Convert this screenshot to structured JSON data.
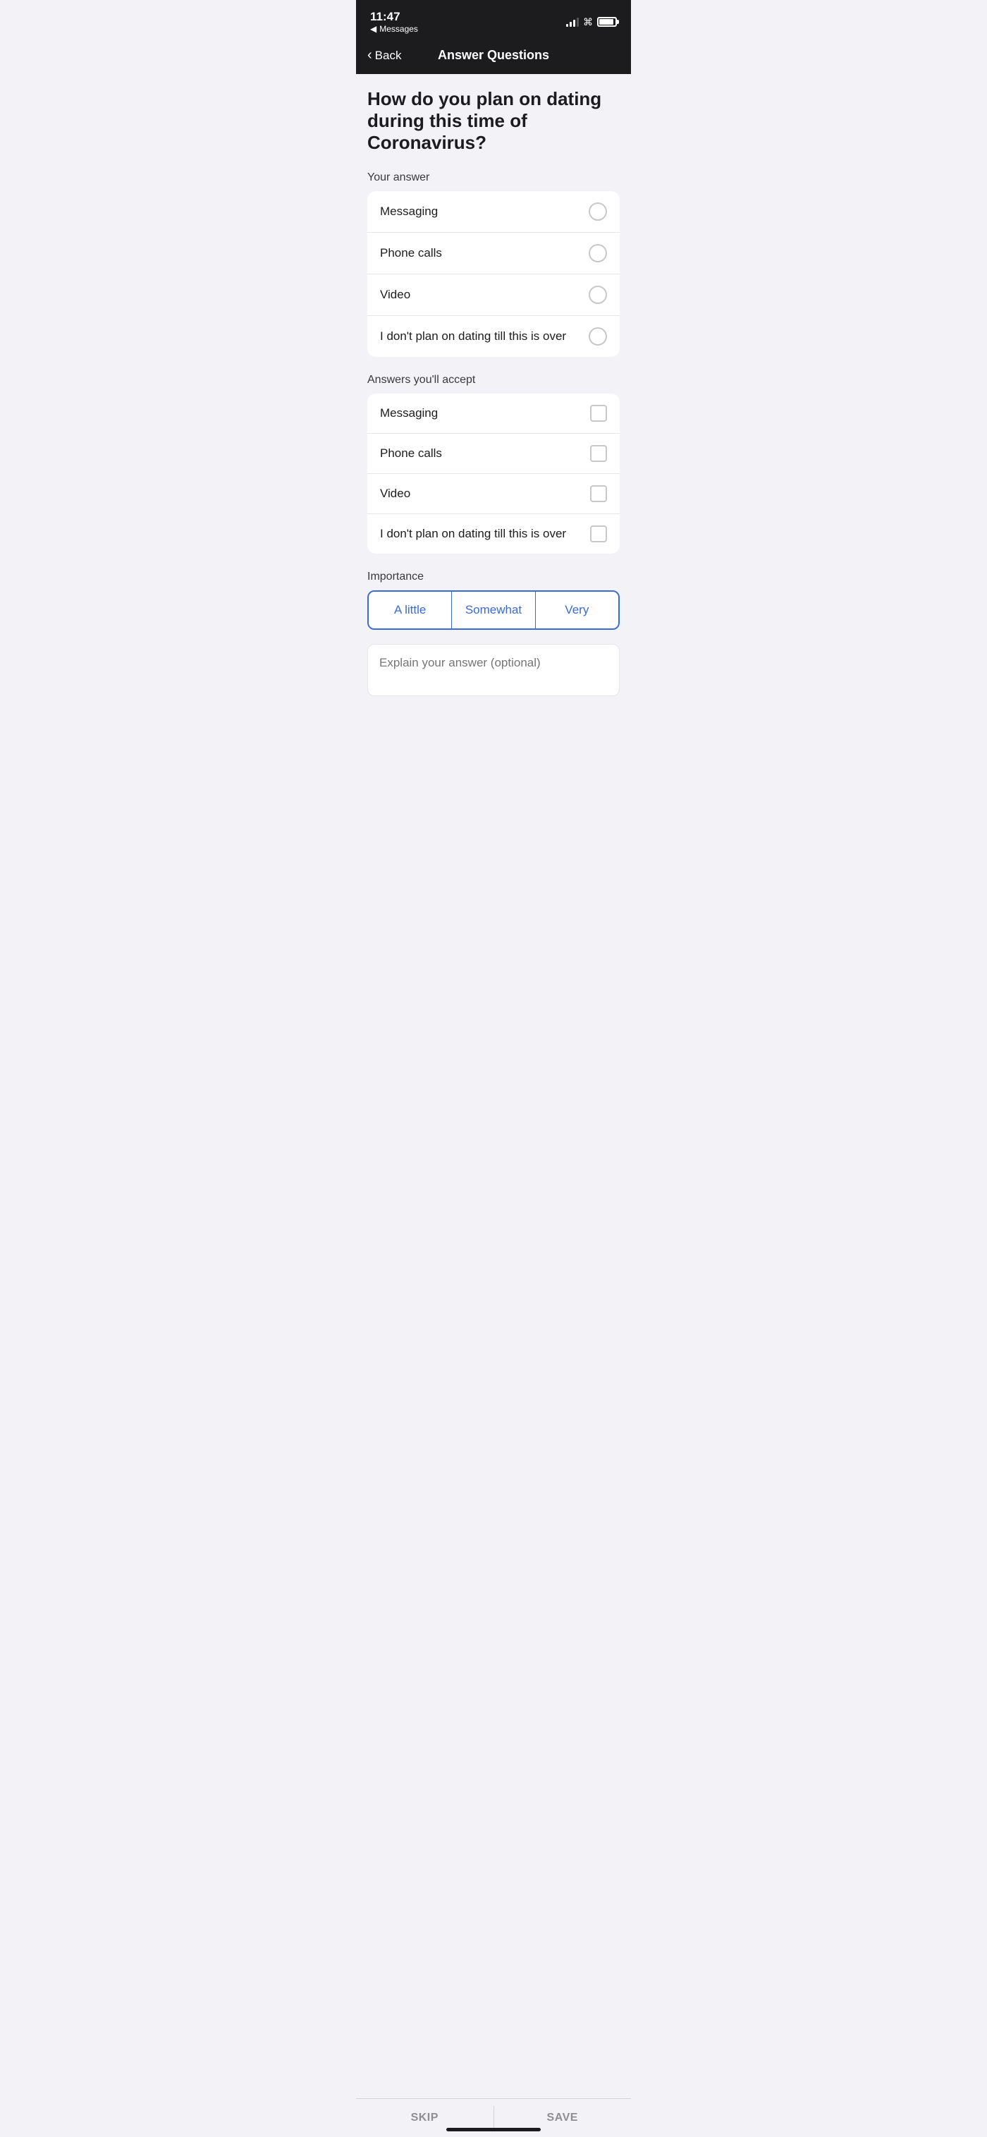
{
  "statusBar": {
    "time": "11:47",
    "messages": "Messages"
  },
  "navBar": {
    "backLabel": "Back",
    "title": "Answer Questions"
  },
  "question": {
    "text": "How do you plan on dating during this time of Coronavirus?"
  },
  "yourAnswer": {
    "label": "Your answer",
    "options": [
      {
        "id": "msg1",
        "label": "Messaging"
      },
      {
        "id": "calls1",
        "label": "Phone calls"
      },
      {
        "id": "video1",
        "label": "Video"
      },
      {
        "id": "nodating1",
        "label": "I don't plan on dating till this is over"
      }
    ]
  },
  "acceptedAnswers": {
    "label": "Answers you'll accept",
    "options": [
      {
        "id": "msg2",
        "label": "Messaging"
      },
      {
        "id": "calls2",
        "label": "Phone calls"
      },
      {
        "id": "video2",
        "label": "Video"
      },
      {
        "id": "nodating2",
        "label": "I don't plan on dating till this is over"
      }
    ]
  },
  "importance": {
    "label": "Importance",
    "buttons": [
      {
        "id": "alittle",
        "label": "A little"
      },
      {
        "id": "somewhat",
        "label": "Somewhat"
      },
      {
        "id": "very",
        "label": "Very"
      }
    ]
  },
  "explainInput": {
    "placeholder": "Explain your answer (optional)"
  },
  "bottomBar": {
    "skipLabel": "SKIP",
    "saveLabel": "SAVE"
  }
}
